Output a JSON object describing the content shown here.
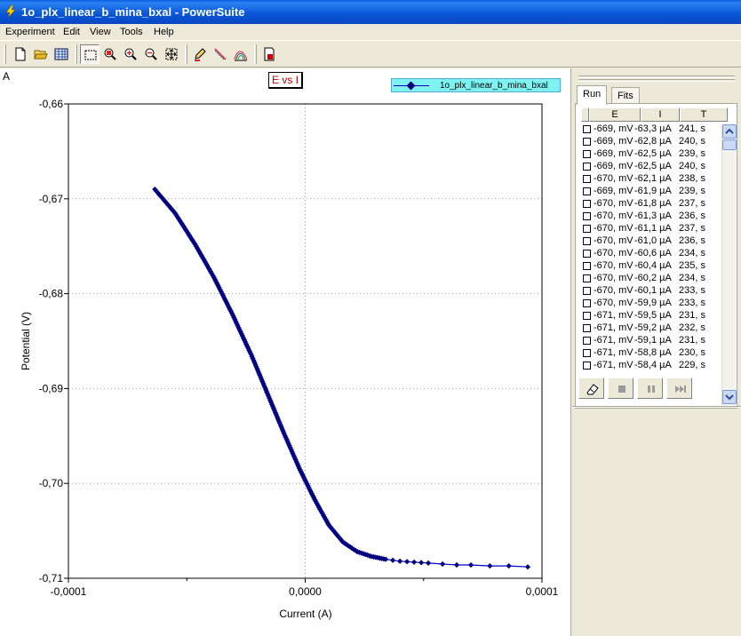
{
  "window": {
    "title": "1o_plx_linear_b_mina_bxal - PowerSuite"
  },
  "menu": [
    "Experiment",
    "Edit",
    "View",
    "Tools",
    "Help"
  ],
  "toolbar": {
    "buttons": [
      {
        "icon": "new-document-icon"
      },
      {
        "icon": "open-folder-icon"
      },
      {
        "icon": "grid-table-icon"
      },
      {
        "icon": "select-rectangle-icon"
      },
      {
        "icon": "zoom-icon"
      },
      {
        "icon": "zoom-in-icon"
      },
      {
        "icon": "zoom-out-icon"
      },
      {
        "icon": "fit-all-icon"
      },
      {
        "icon": "pencil-icon"
      },
      {
        "icon": "line-tool-icon"
      },
      {
        "icon": "curves-icon"
      },
      {
        "icon": "record-icon"
      }
    ]
  },
  "chart_panel": {
    "corner_label": "A",
    "legend_series": "1o_plx_linear_b_mina_bxal"
  },
  "chart_data": {
    "type": "line",
    "title": "E vs I",
    "xlabel": "Current (A)",
    "ylabel": "Potential (V)",
    "xlim": [
      -0.0001,
      0.0001
    ],
    "ylim": [
      -0.71,
      -0.66
    ],
    "x_ticks": [
      "-0,0001",
      "0,0000",
      "0,0001"
    ],
    "y_ticks": [
      "-0,66",
      "-0,67",
      "-0,68",
      "-0,69",
      "-0,70",
      "-0,71"
    ],
    "grid": true,
    "legend_position": "top-right",
    "color": "#0000cc",
    "series": [
      {
        "name": "1o_plx_linear_b_mina_bxal",
        "x": [
          -6.35e-05,
          -5.5e-05,
          -4.65e-05,
          -3.85e-05,
          -3.05e-05,
          -2.25e-05,
          -1.55e-05,
          -9e-06,
          -2.5e-06,
          4e-06,
          1e-05,
          1.6e-05,
          2.2e-05,
          2.8e-05,
          3.4e-05,
          4e-05,
          4.6e-05,
          5.2e-05,
          5.8e-05,
          6.4e-05,
          7e-05,
          7.8e-05,
          8.6e-05,
          9.4e-05
        ],
        "y": [
          -0.669,
          -0.6715,
          -0.6748,
          -0.6783,
          -0.6823,
          -0.6866,
          -0.6908,
          -0.6947,
          -0.6984,
          -0.7017,
          -0.7044,
          -0.7062,
          -0.7072,
          -0.7077,
          -0.708,
          -0.7082,
          -0.7083,
          -0.7084,
          -0.7085,
          -0.7086,
          -0.7086,
          -0.7087,
          -0.7087,
          -0.7088
        ]
      }
    ]
  },
  "side_panel": {
    "tabs": [
      "Run",
      "Fits"
    ],
    "columns": [
      "E",
      "I",
      "T"
    ],
    "rows": [
      {
        "e": "-669, mV",
        "i": "-63,3 µA",
        "t": "241, s"
      },
      {
        "e": "-669, mV",
        "i": "-62,8 µA",
        "t": "240, s"
      },
      {
        "e": "-669, mV",
        "i": "-62,5 µA",
        "t": "239, s"
      },
      {
        "e": "-669, mV",
        "i": "-62,5 µA",
        "t": "240, s"
      },
      {
        "e": "-670, mV",
        "i": "-62,1 µA",
        "t": "238, s"
      },
      {
        "e": "-669, mV",
        "i": "-61,9 µA",
        "t": "239, s"
      },
      {
        "e": "-670, mV",
        "i": "-61,8 µA",
        "t": "237, s"
      },
      {
        "e": "-670, mV",
        "i": "-61,3 µA",
        "t": "236, s"
      },
      {
        "e": "-670, mV",
        "i": "-61,1 µA",
        "t": "237, s"
      },
      {
        "e": "-670, mV",
        "i": "-61,0 µA",
        "t": "236, s"
      },
      {
        "e": "-670, mV",
        "i": "-60,6 µA",
        "t": "234, s"
      },
      {
        "e": "-670, mV",
        "i": "-60,4 µA",
        "t": "235, s"
      },
      {
        "e": "-670, mV",
        "i": "-60,2 µA",
        "t": "234, s"
      },
      {
        "e": "-670, mV",
        "i": "-60,1 µA",
        "t": "233, s"
      },
      {
        "e": "-670, mV",
        "i": "-59,9 µA",
        "t": "233, s"
      },
      {
        "e": "-671, mV",
        "i": "-59,5 µA",
        "t": "231, s"
      },
      {
        "e": "-671, mV",
        "i": "-59,2 µA",
        "t": "232, s"
      },
      {
        "e": "-671, mV",
        "i": "-59,1 µA",
        "t": "231, s"
      },
      {
        "e": "-671, mV",
        "i": "-58,8 µA",
        "t": "230, s"
      },
      {
        "e": "-671, mV",
        "i": "-58,4 µA",
        "t": "229, s"
      }
    ],
    "controls": [
      {
        "icon": "eraser-icon"
      },
      {
        "icon": "stop-icon"
      },
      {
        "icon": "pause-icon"
      },
      {
        "icon": "skip-forward-icon"
      }
    ]
  }
}
